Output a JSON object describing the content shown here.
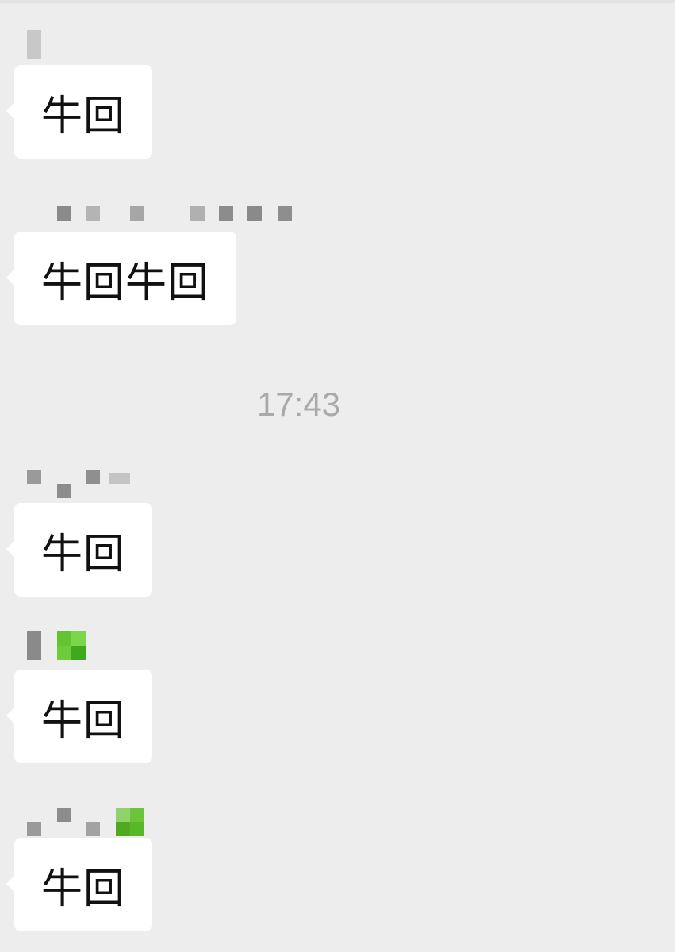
{
  "chat": {
    "messages": [
      {
        "sender": "",
        "text": "牛回"
      },
      {
        "sender": "",
        "text": "牛回牛回"
      },
      {
        "sender": "",
        "text": "牛回"
      },
      {
        "sender": "",
        "text": "牛回"
      },
      {
        "sender": "",
        "text": "牛回"
      }
    ],
    "timestamp": "17:43"
  },
  "colors": {
    "background": "#ededed",
    "bubble": "#ffffff",
    "text": "#111111",
    "timestamp": "#a9a9a9",
    "mosaic_gray": "#8a8a8a",
    "mosaic_green": "#6ac93a"
  }
}
